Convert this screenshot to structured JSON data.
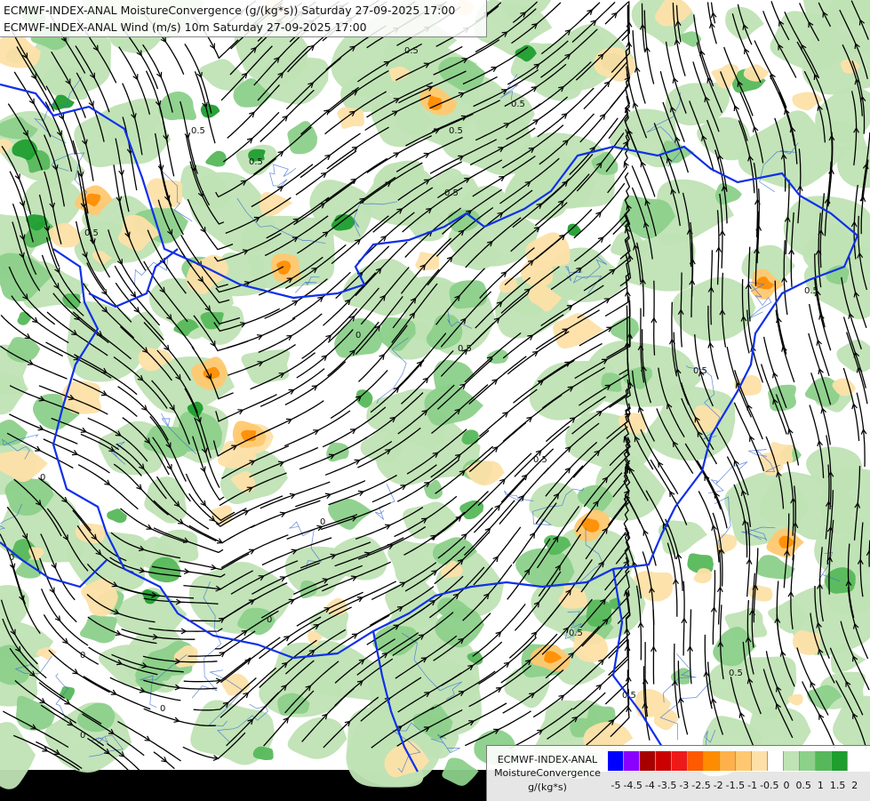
{
  "header": {
    "line1": "ECMWF-INDEX-ANAL MoistureConvergence (g/(kg*s)) Saturday 27-09-2025 17:00",
    "line2": "ECMWF-INDEX-ANAL Wind (m/s) 10m Saturday 27-09-2025 17:00"
  },
  "legend": {
    "model": "ECMWF-INDEX-ANAL",
    "parameter": "MoistureConvergence",
    "unit": "g/(kg*s)",
    "ticks": [
      "-5",
      "-4.5",
      "-4",
      "-3.5",
      "-3",
      "-2.5",
      "-2",
      "-1.5",
      "-1",
      "-0.5",
      "0",
      "0.5",
      "1",
      "1.5",
      "2"
    ],
    "colors": [
      "#0000ff",
      "#8a00ff",
      "#a80000",
      "#cc0000",
      "#ee1a1a",
      "#ff5a00",
      "#ff8c00",
      "#ffb04a",
      "#ffc870",
      "#fde0a8",
      "#ffffff",
      "#bfe3b4",
      "#8cd08a",
      "#56b85a",
      "#1f9e2f"
    ]
  },
  "contour_labels": [
    "0.5",
    "0.5",
    "0.5",
    "0",
    "0.5",
    "0",
    "0.5",
    "0.5",
    "0",
    "0.5",
    "0",
    "0.5",
    "0",
    "0.5",
    "0.5",
    "0",
    "0.5",
    "0.5",
    "0",
    "0.5",
    "0",
    "0.5"
  ],
  "map_colors": {
    "background": "#ffffff",
    "convergence_light": "#bfe3b4",
    "convergence_mid": "#8cd08a",
    "convergence_strong": "#56b85a",
    "convergence_max": "#1f9e2f",
    "divergence_light": "#fde0a8",
    "divergence_mid": "#ffc870",
    "divergence_strong": "#ff8c00",
    "border": "#1030e8",
    "river": "#3a6ad0",
    "streamline": "#000000"
  }
}
